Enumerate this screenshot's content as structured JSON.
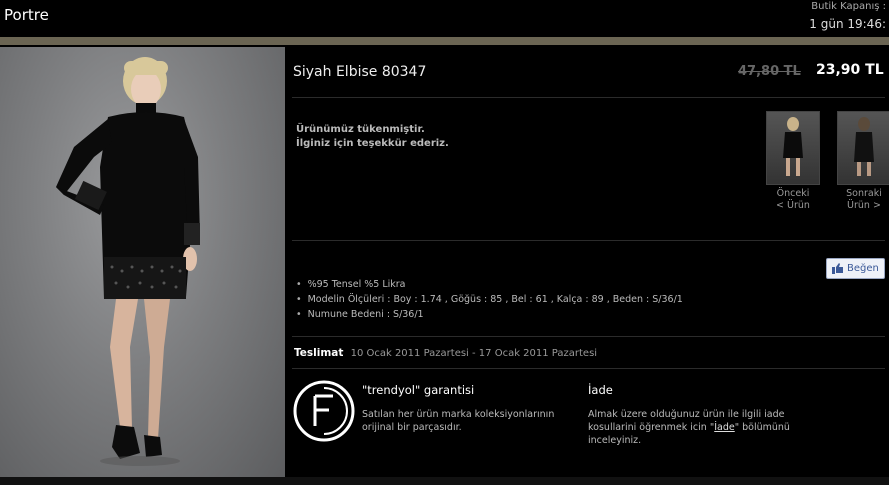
{
  "header": {
    "brand": "Portre",
    "closing_label": "Butik Kapanış :",
    "closing_time": "1 gün 19:46:"
  },
  "product": {
    "name": "Siyah Elbise 80347",
    "old_price": "47,80 TL",
    "new_price": "23,90 TL",
    "soldout_line1": "Ürünümüz tükenmiştir.",
    "soldout_line2": "İlginiz için teşekkür ederiz."
  },
  "nav": {
    "prev_line1": "Önceki",
    "prev_line2": "< Ürün",
    "next_line1": "Sonraki",
    "next_line2": "Ürün >"
  },
  "like_label": "Beğen",
  "features": [
    "%95 Tensel %5 Likra",
    "Modelin Ölçüleri : Boy : 1.74 , Göğüs : 85 , Bel : 61 , Kalça : 89 , Beden : S/36/1",
    "Numune Bedeni : S/36/1"
  ],
  "delivery": {
    "label": "Teslimat",
    "dates": "10 Ocak 2011 Pazartesi - 17 Ocak 2011 Pazartesi"
  },
  "guarantee": {
    "title": "\"trendyol\" garantisi",
    "text": "Satılan her ürün marka koleksiyonlarının orijinal bir parçasıdır."
  },
  "returns": {
    "title": "İade",
    "text_before": "Almak üzere olduğunuz ürün ile ilgili iade kosullarini öğrenmek icin \"",
    "link": "İade",
    "text_after": "\" bölümünü inceleyiniz."
  },
  "colors": {
    "background": "#000000",
    "accent_strip": "#6b6553",
    "facebook_blue": "#3b5998"
  }
}
